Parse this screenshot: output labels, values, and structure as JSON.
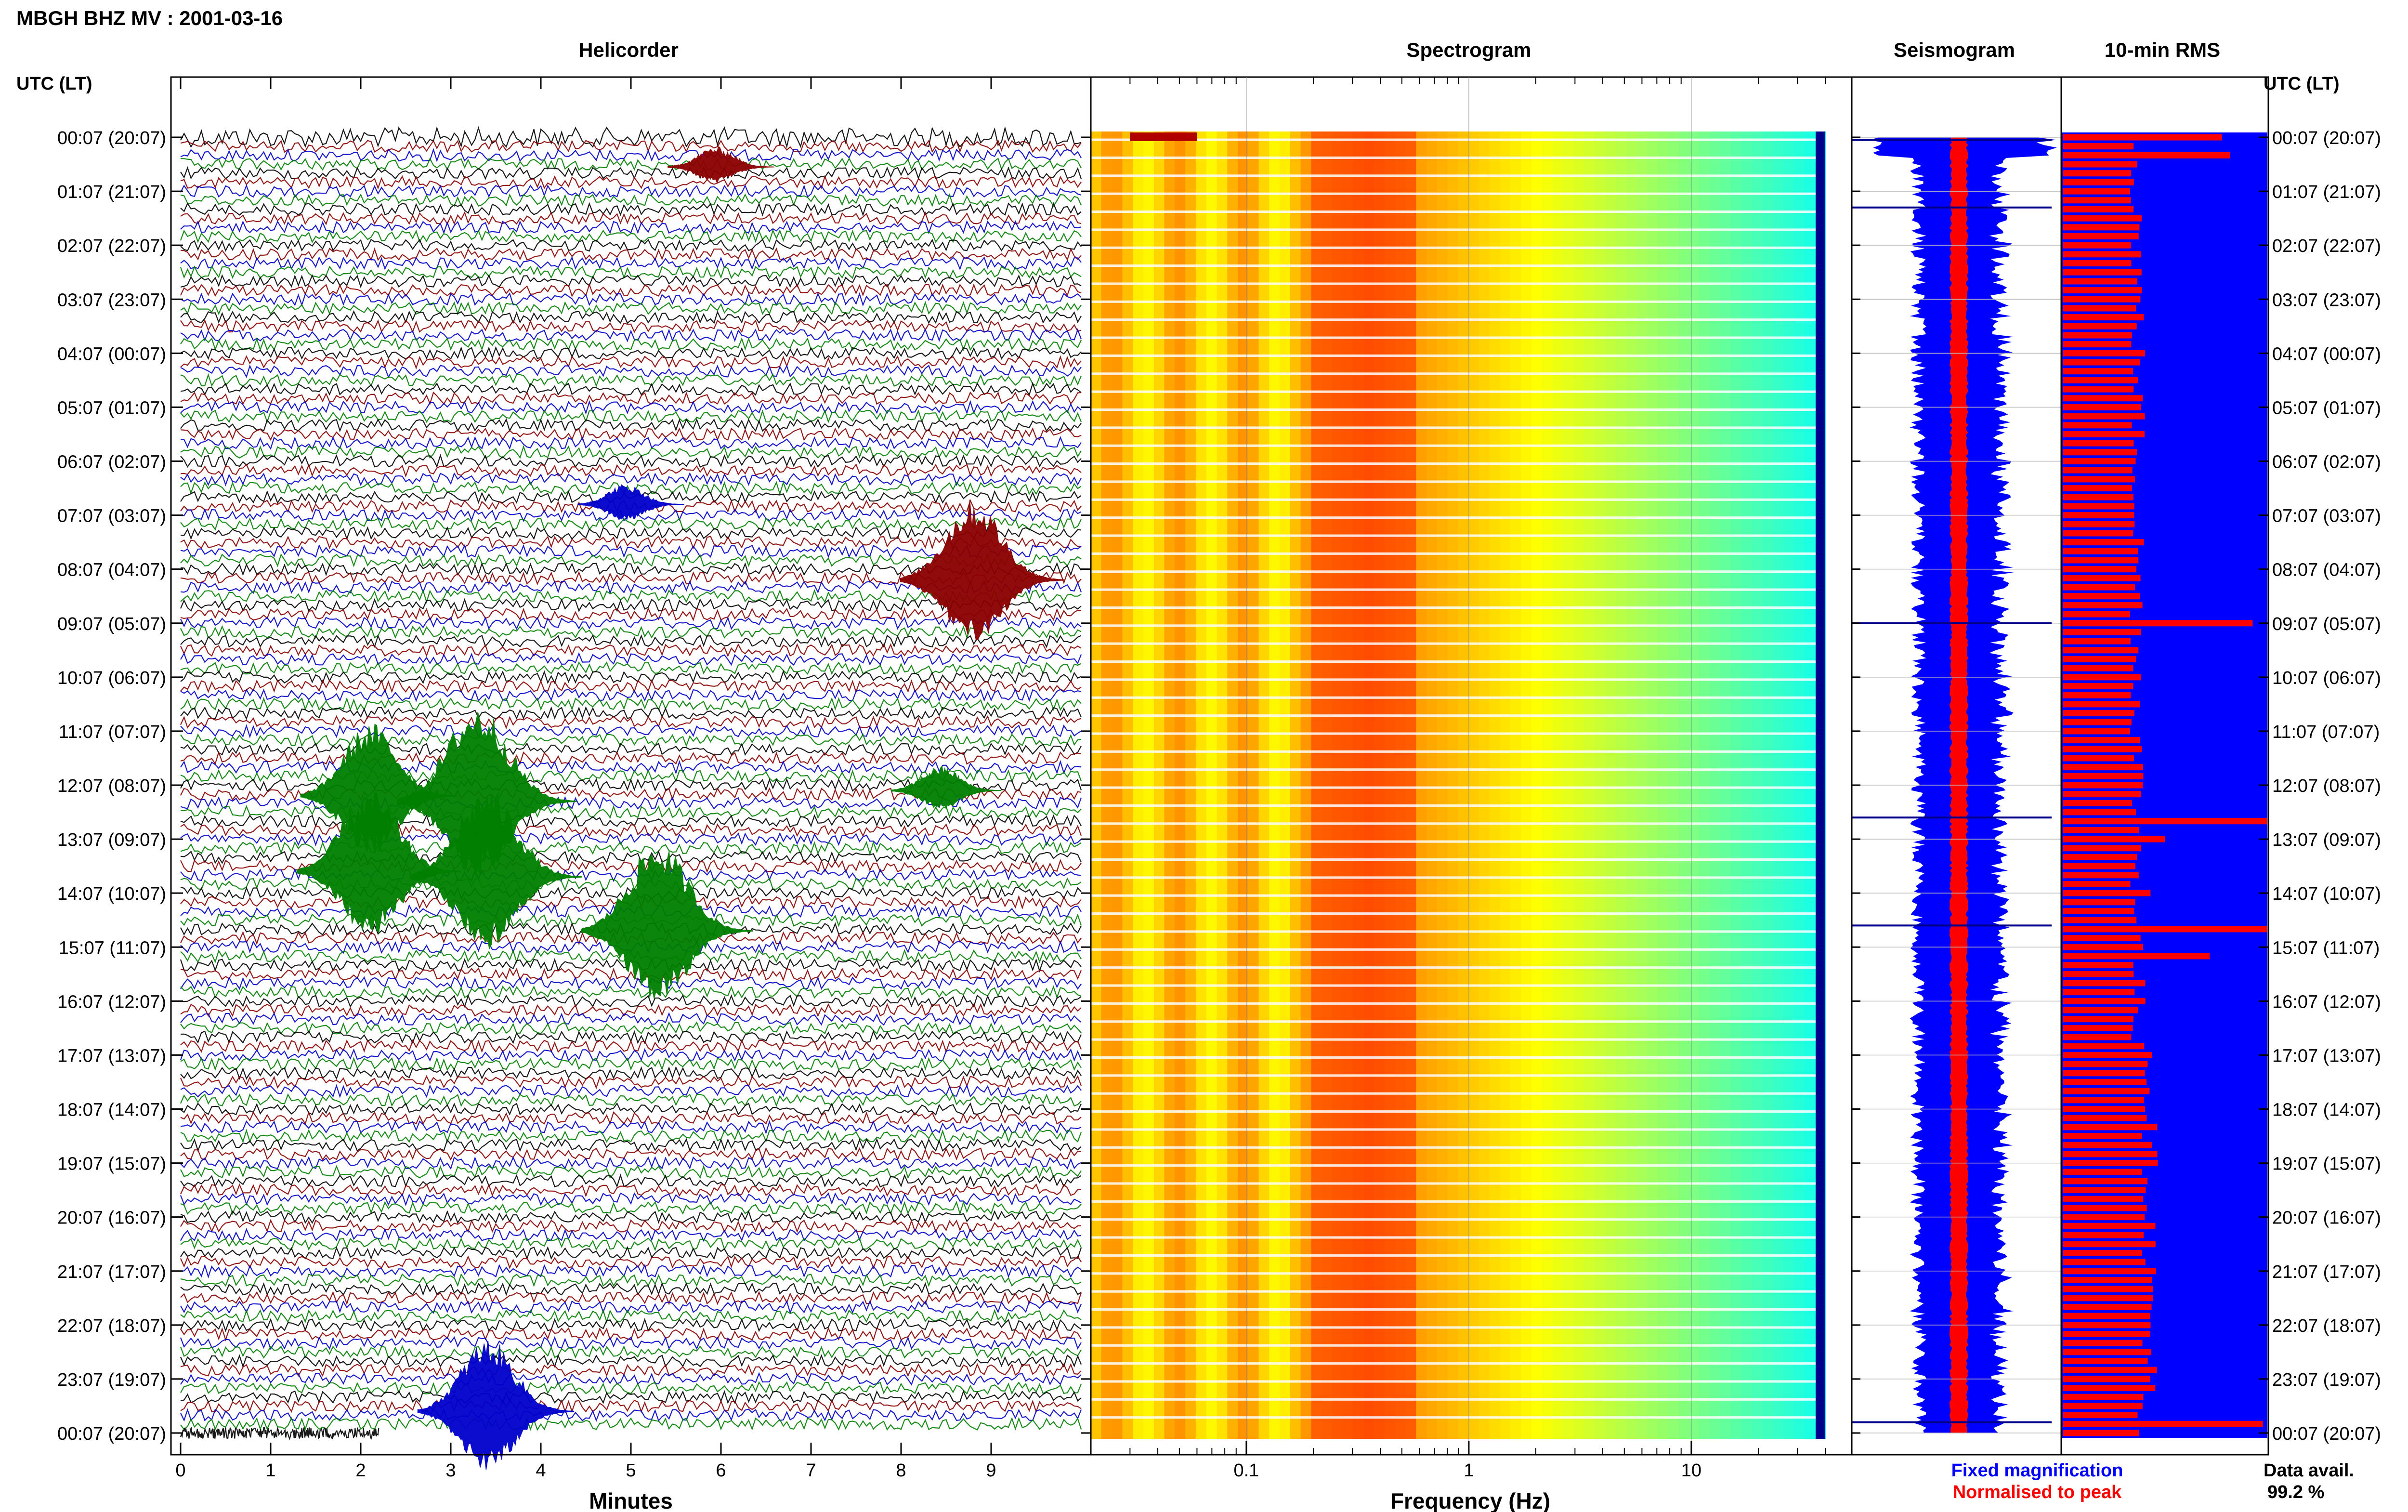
{
  "header": {
    "title": "MBGH BHZ MV : 2001-03-16",
    "utc_label_left": "UTC (LT)",
    "utc_label_right": "UTC (LT)"
  },
  "panels": {
    "helicorder": "Helicorder",
    "spectrogram": "Spectrogram",
    "seismogram": "Seismogram",
    "rms": "10-min RMS"
  },
  "axes": {
    "minutes_label": "Minutes",
    "frequency_label": "Frequency (Hz)",
    "minute_ticks": [
      "0",
      "1",
      "2",
      "3",
      "4",
      "5",
      "6",
      "7",
      "8",
      "9"
    ],
    "freq_ticks": [
      "0.1",
      "1",
      "10"
    ]
  },
  "legend": {
    "fixed": "Fixed magnification",
    "normalised": "Normalised to peak",
    "fixed_color": "#0000ff",
    "normalised_color": "#ff0000"
  },
  "availability": {
    "label": "Data avail.",
    "value": "99.2 %"
  },
  "time_labels": [
    "00:07 (20:07)",
    "01:07 (21:07)",
    "02:07 (22:07)",
    "03:07 (23:07)",
    "04:07 (00:07)",
    "05:07 (01:07)",
    "06:07 (02:07)",
    "07:07 (03:07)",
    "08:07 (04:07)",
    "09:07 (05:07)",
    "10:07 (06:07)",
    "11:07 (07:07)",
    "12:07 (08:07)",
    "13:07 (09:07)",
    "14:07 (10:07)",
    "15:07 (11:07)",
    "16:07 (12:07)",
    "17:07 (13:07)",
    "18:07 (14:07)",
    "19:07 (15:07)",
    "20:07 (16:07)",
    "21:07 (17:07)",
    "22:07 (18:07)",
    "23:07 (19:07)",
    "00:07 (20:07)"
  ],
  "chart_data": [
    {
      "type": "line",
      "panel": "Helicorder",
      "xlabel": "Minutes",
      "xlim": [
        0,
        10
      ],
      "trace_colors": [
        "#000000",
        "#8b0000",
        "#0000cd",
        "#007f00"
      ],
      "hours": 24,
      "lines_per_hour": 6,
      "events": [
        {
          "hour": 0.55,
          "minute": 6.0,
          "amp": 0.25,
          "color": "#8b0000"
        },
        {
          "hour": 6.8,
          "minute": 5.0,
          "amp": 0.25,
          "color": "#0000cd"
        },
        {
          "hour": 8.2,
          "minute": 8.9,
          "amp": 1.0,
          "color": "#8b0000"
        },
        {
          "hour": 12.2,
          "minute": 2.2,
          "amp": 0.9,
          "color": "#007f00"
        },
        {
          "hour": 12.3,
          "minute": 3.4,
          "amp": 1.2,
          "color": "#007f00"
        },
        {
          "hour": 12.1,
          "minute": 8.5,
          "amp": 0.3,
          "color": "#007f00"
        },
        {
          "hour": 13.6,
          "minute": 2.2,
          "amp": 1.0,
          "color": "#007f00"
        },
        {
          "hour": 13.7,
          "minute": 3.5,
          "amp": 1.1,
          "color": "#007f00"
        },
        {
          "hour": 14.7,
          "minute": 5.4,
          "amp": 1.1,
          "color": "#007f00"
        },
        {
          "hour": 23.6,
          "minute": 3.5,
          "amp": 0.9,
          "color": "#0000cd"
        }
      ]
    },
    {
      "type": "heatmap",
      "panel": "Spectrogram",
      "xlabel": "Frequency (Hz)",
      "xscale": "log",
      "xlim": [
        0.02,
        40
      ],
      "hours": 24,
      "colormap": "jet",
      "peak_band_hz": [
        0.2,
        0.6
      ]
    },
    {
      "type": "line",
      "panel": "Seismogram",
      "series": [
        {
          "name": "Fixed magnification",
          "color": "#0000ff"
        },
        {
          "name": "Normalised to peak",
          "color": "#ff0000"
        }
      ],
      "spikes_at_hours": [
        0.05,
        1.3,
        9.0,
        12.6,
        14.6,
        23.8
      ]
    },
    {
      "type": "bar",
      "panel": "10-min RMS",
      "orientation": "horizontal",
      "hours": 24,
      "bars_per_hour": 6,
      "baseline_fraction": 0.36,
      "spikes": [
        {
          "hour": 0.0,
          "value": 0.78
        },
        {
          "hour": 0.3,
          "value": 0.82
        },
        {
          "hour": 9.0,
          "value": 0.93
        },
        {
          "hour": 12.6,
          "value": 1.0
        },
        {
          "hour": 13.0,
          "value": 0.5
        },
        {
          "hour": 14.0,
          "value": 0.43
        },
        {
          "hour": 14.6,
          "value": 1.0
        },
        {
          "hour": 15.2,
          "value": 0.72
        },
        {
          "hour": 23.9,
          "value": 0.98
        }
      ]
    }
  ]
}
